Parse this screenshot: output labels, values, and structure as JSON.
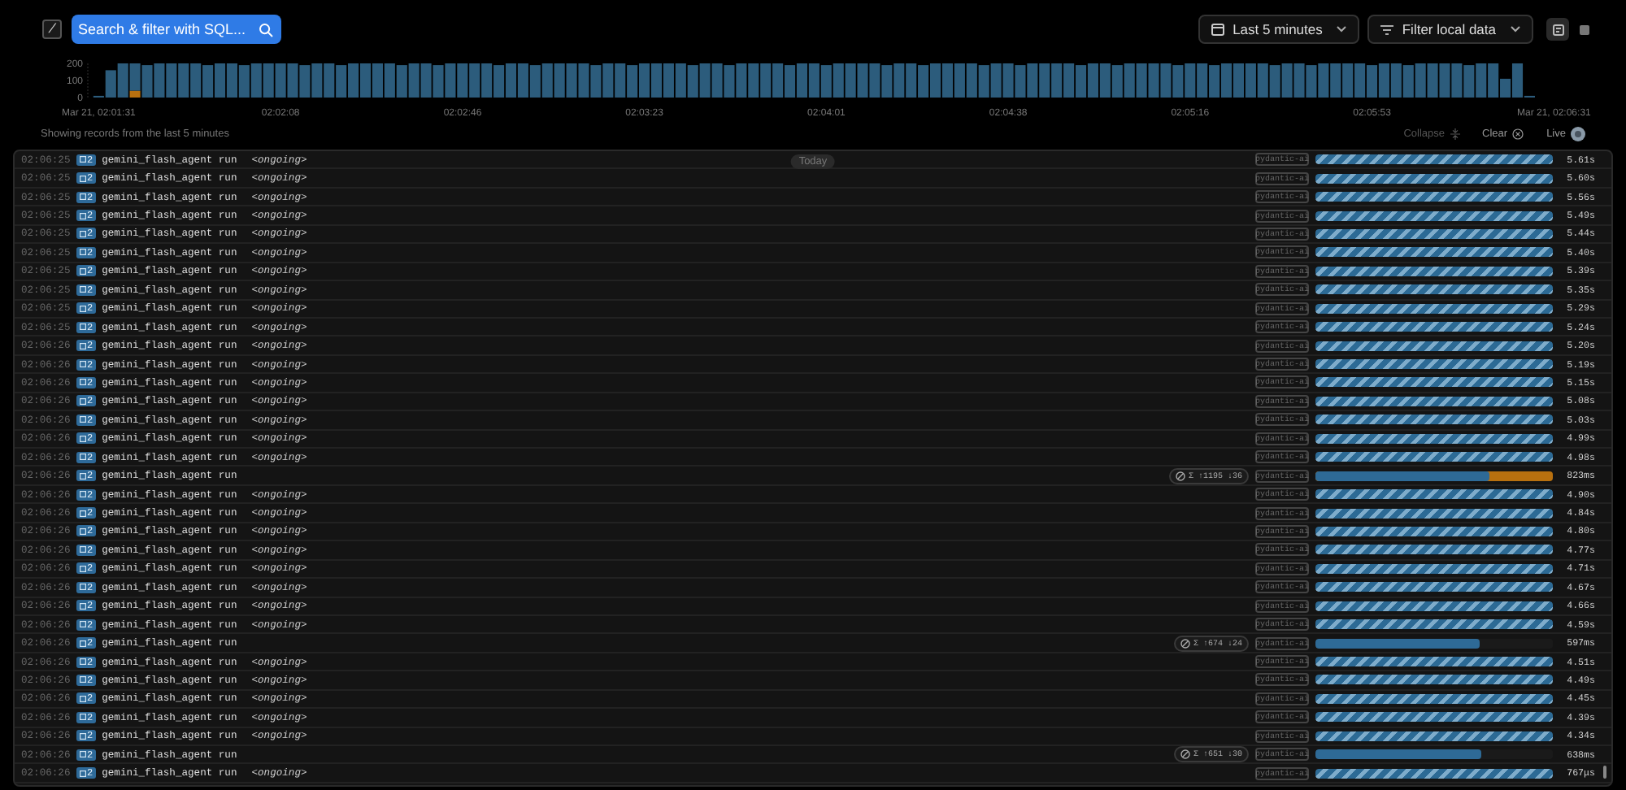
{
  "toolbar": {
    "shortcut_key": "/",
    "search": {
      "label": "Search & filter with SQL..."
    },
    "time_range": "Last 5 minutes",
    "filter": "Filter local data",
    "views": [
      {
        "kind": "timeline",
        "selected": true
      },
      {
        "kind": "list",
        "selected": false
      }
    ]
  },
  "chart_data": {
    "type": "bar",
    "stacked": true,
    "ylim": [
      0,
      200
    ],
    "yticks": [
      {
        "value": 0,
        "label": "0"
      },
      {
        "value": 100,
        "label": "100"
      },
      {
        "value": 200,
        "label": "200"
      }
    ],
    "categories": [
      "Mar 21, 02:01:31",
      null,
      null,
      null,
      null,
      null,
      null,
      null,
      null,
      null,
      null,
      null,
      null,
      null,
      null,
      "02:02:08",
      null,
      null,
      null,
      null,
      null,
      null,
      null,
      null,
      null,
      null,
      null,
      null,
      null,
      null,
      "02:02:46",
      null,
      null,
      null,
      null,
      null,
      null,
      null,
      null,
      null,
      null,
      null,
      null,
      null,
      null,
      "02:03:23",
      null,
      null,
      null,
      null,
      null,
      null,
      null,
      null,
      null,
      null,
      null,
      null,
      null,
      null,
      "02:04:01",
      null,
      null,
      null,
      null,
      null,
      null,
      null,
      null,
      null,
      null,
      null,
      null,
      null,
      null,
      "02:04:38",
      null,
      null,
      null,
      null,
      null,
      null,
      null,
      null,
      null,
      null,
      null,
      null,
      null,
      null,
      "02:05:16",
      null,
      null,
      null,
      null,
      null,
      null,
      null,
      null,
      null,
      null,
      null,
      null,
      null,
      null,
      "02:05:53",
      null,
      null,
      null,
      null,
      null,
      null,
      null,
      null,
      null,
      null,
      null,
      null,
      null,
      null,
      "Mar 21, 02:06:31"
    ],
    "series": [
      {
        "color": "#b8700f",
        "values": [
          0,
          0,
          0,
          40,
          0,
          0,
          0,
          0,
          0,
          0,
          0,
          0,
          0,
          0,
          0,
          0,
          0,
          0,
          0,
          0,
          0,
          0,
          0,
          0,
          0,
          0,
          0,
          0,
          0,
          0,
          0,
          0,
          0,
          0,
          0,
          0,
          0,
          0,
          0,
          0,
          0,
          0,
          0,
          0,
          0,
          0,
          0,
          0,
          0,
          0,
          0,
          0,
          0,
          0,
          0,
          0,
          0,
          0,
          0,
          0,
          0,
          0,
          0,
          0,
          0,
          0,
          0,
          0,
          0,
          0,
          0,
          0,
          0,
          0,
          0,
          0,
          0,
          0,
          0,
          0,
          0,
          0,
          0,
          0,
          0,
          0,
          0,
          0,
          0,
          0,
          0,
          0,
          0,
          0,
          0,
          0,
          0,
          0,
          0,
          0,
          0,
          0,
          0,
          0,
          0,
          0,
          0,
          0,
          0,
          0,
          0,
          0,
          0,
          0,
          0,
          0,
          0,
          0,
          0,
          0,
          0
        ]
      },
      {
        "color": "#2c5c7c",
        "values": [
          10,
          160,
          200,
          160,
          190,
          200,
          200,
          200,
          200,
          190,
          200,
          200,
          190,
          200,
          200,
          200,
          200,
          190,
          200,
          200,
          190,
          200,
          200,
          200,
          200,
          190,
          200,
          200,
          190,
          200,
          200,
          200,
          200,
          190,
          200,
          200,
          190,
          200,
          200,
          200,
          200,
          190,
          200,
          200,
          190,
          200,
          200,
          200,
          200,
          190,
          200,
          200,
          190,
          200,
          200,
          200,
          200,
          190,
          200,
          200,
          190,
          200,
          200,
          200,
          200,
          190,
          200,
          200,
          190,
          200,
          200,
          200,
          200,
          190,
          200,
          200,
          190,
          200,
          200,
          200,
          200,
          190,
          200,
          200,
          190,
          200,
          200,
          200,
          200,
          190,
          200,
          200,
          190,
          200,
          200,
          200,
          200,
          190,
          200,
          200,
          190,
          200,
          200,
          200,
          200,
          190,
          200,
          200,
          190,
          200,
          200,
          200,
          200,
          190,
          200,
          200,
          110,
          200,
          10,
          0,
          0
        ]
      }
    ]
  },
  "status": {
    "text": "Showing records from the last 5 minutes",
    "collapse": {
      "label": "Collapse",
      "disabled": true
    },
    "clear": "Clear",
    "live": "Live"
  },
  "date_divider": "Today",
  "rows": [
    {
      "time": "02:06:25",
      "count": "2",
      "name": "gemini_flash_agent run",
      "status": "<ongoing>",
      "tag": "pydantic-ai",
      "bar": {
        "kind": "striped",
        "level": 1
      },
      "duration": "5.61s"
    },
    {
      "time": "02:06:25",
      "count": "2",
      "name": "gemini_flash_agent run",
      "status": "<ongoing>",
      "tag": "pydantic-ai",
      "bar": {
        "kind": "striped",
        "level": 1
      },
      "duration": "5.60s"
    },
    {
      "time": "02:06:25",
      "count": "2",
      "name": "gemini_flash_agent run",
      "status": "<ongoing>",
      "tag": "pydantic-ai",
      "bar": {
        "kind": "striped",
        "level": 1
      },
      "duration": "5.56s"
    },
    {
      "time": "02:06:25",
      "count": "2",
      "name": "gemini_flash_agent run",
      "status": "<ongoing>",
      "tag": "pydantic-ai",
      "bar": {
        "kind": "striped",
        "level": 1
      },
      "duration": "5.49s"
    },
    {
      "time": "02:06:25",
      "count": "2",
      "name": "gemini_flash_agent run",
      "status": "<ongoing>",
      "tag": "pydantic-ai",
      "bar": {
        "kind": "striped",
        "level": 1
      },
      "duration": "5.44s"
    },
    {
      "time": "02:06:25",
      "count": "2",
      "name": "gemini_flash_agent run",
      "status": "<ongoing>",
      "tag": "pydantic-ai",
      "bar": {
        "kind": "striped",
        "level": 1
      },
      "duration": "5.40s"
    },
    {
      "time": "02:06:25",
      "count": "2",
      "name": "gemini_flash_agent run",
      "status": "<ongoing>",
      "tag": "pydantic-ai",
      "bar": {
        "kind": "striped",
        "level": 1
      },
      "duration": "5.39s"
    },
    {
      "time": "02:06:25",
      "count": "2",
      "name": "gemini_flash_agent run",
      "status": "<ongoing>",
      "tag": "pydantic-ai",
      "bar": {
        "kind": "striped",
        "level": 1
      },
      "duration": "5.35s"
    },
    {
      "time": "02:06:25",
      "count": "2",
      "name": "gemini_flash_agent run",
      "status": "<ongoing>",
      "tag": "pydantic-ai",
      "bar": {
        "kind": "striped",
        "level": 1
      },
      "duration": "5.29s"
    },
    {
      "time": "02:06:25",
      "count": "2",
      "name": "gemini_flash_agent run",
      "status": "<ongoing>",
      "tag": "pydantic-ai",
      "bar": {
        "kind": "striped",
        "level": 1
      },
      "duration": "5.24s"
    },
    {
      "time": "02:06:26",
      "count": "2",
      "name": "gemini_flash_agent run",
      "status": "<ongoing>",
      "tag": "pydantic-ai",
      "bar": {
        "kind": "striped",
        "level": 1
      },
      "duration": "5.20s"
    },
    {
      "time": "02:06:26",
      "count": "2",
      "name": "gemini_flash_agent run",
      "status": "<ongoing>",
      "tag": "pydantic-ai",
      "bar": {
        "kind": "striped",
        "level": 1
      },
      "duration": "5.19s"
    },
    {
      "time": "02:06:26",
      "count": "2",
      "name": "gemini_flash_agent run",
      "status": "<ongoing>",
      "tag": "pydantic-ai",
      "bar": {
        "kind": "striped",
        "level": 1
      },
      "duration": "5.15s"
    },
    {
      "time": "02:06:26",
      "count": "2",
      "name": "gemini_flash_agent run",
      "status": "<ongoing>",
      "tag": "pydantic-ai",
      "bar": {
        "kind": "striped",
        "level": 1
      },
      "duration": "5.08s"
    },
    {
      "time": "02:06:26",
      "count": "2",
      "name": "gemini_flash_agent run",
      "status": "<ongoing>",
      "tag": "pydantic-ai",
      "bar": {
        "kind": "striped",
        "level": 1
      },
      "duration": "5.03s"
    },
    {
      "time": "02:06:26",
      "count": "2",
      "name": "gemini_flash_agent run",
      "status": "<ongoing>",
      "tag": "pydantic-ai",
      "bar": {
        "kind": "striped",
        "level": 1
      },
      "duration": "4.99s"
    },
    {
      "time": "02:06:26",
      "count": "2",
      "name": "gemini_flash_agent run",
      "status": "<ongoing>",
      "tag": "pydantic-ai",
      "bar": {
        "kind": "striped",
        "level": 1
      },
      "duration": "4.98s"
    },
    {
      "time": "02:06:26",
      "count": "2",
      "name": "gemini_flash_agent run",
      "tokens": "Σ ↑1195 ↓36",
      "tag": "pydantic-ai",
      "bar": {
        "kind": "solid",
        "level": 0.73,
        "error": true
      },
      "duration": "823ms"
    },
    {
      "time": "02:06:26",
      "count": "2",
      "name": "gemini_flash_agent run",
      "status": "<ongoing>",
      "tag": "pydantic-ai",
      "bar": {
        "kind": "striped",
        "level": 1
      },
      "duration": "4.90s"
    },
    {
      "time": "02:06:26",
      "count": "2",
      "name": "gemini_flash_agent run",
      "status": "<ongoing>",
      "tag": "pydantic-ai",
      "bar": {
        "kind": "striped",
        "level": 1
      },
      "duration": "4.84s"
    },
    {
      "time": "02:06:26",
      "count": "2",
      "name": "gemini_flash_agent run",
      "status": "<ongoing>",
      "tag": "pydantic-ai",
      "bar": {
        "kind": "striped",
        "level": 1
      },
      "duration": "4.80s"
    },
    {
      "time": "02:06:26",
      "count": "2",
      "name": "gemini_flash_agent run",
      "status": "<ongoing>",
      "tag": "pydantic-ai",
      "bar": {
        "kind": "striped",
        "level": 1
      },
      "duration": "4.77s"
    },
    {
      "time": "02:06:26",
      "count": "2",
      "name": "gemini_flash_agent run",
      "status": "<ongoing>",
      "tag": "pydantic-ai",
      "bar": {
        "kind": "striped",
        "level": 1
      },
      "duration": "4.71s"
    },
    {
      "time": "02:06:26",
      "count": "2",
      "name": "gemini_flash_agent run",
      "status": "<ongoing>",
      "tag": "pydantic-ai",
      "bar": {
        "kind": "striped",
        "level": 1
      },
      "duration": "4.67s"
    },
    {
      "time": "02:06:26",
      "count": "2",
      "name": "gemini_flash_agent run",
      "status": "<ongoing>",
      "tag": "pydantic-ai",
      "bar": {
        "kind": "striped",
        "level": 1
      },
      "duration": "4.66s"
    },
    {
      "time": "02:06:26",
      "count": "2",
      "name": "gemini_flash_agent run",
      "status": "<ongoing>",
      "tag": "pydantic-ai",
      "bar": {
        "kind": "striped",
        "level": 1
      },
      "duration": "4.59s"
    },
    {
      "time": "02:06:26",
      "count": "2",
      "name": "gemini_flash_agent run",
      "tokens": "Σ ↑674 ↓24",
      "tag": "pydantic-ai",
      "bar": {
        "kind": "solid",
        "level": 0.69,
        "error": false
      },
      "duration": "597ms"
    },
    {
      "time": "02:06:26",
      "count": "2",
      "name": "gemini_flash_agent run",
      "status": "<ongoing>",
      "tag": "pydantic-ai",
      "bar": {
        "kind": "striped",
        "level": 1
      },
      "duration": "4.51s"
    },
    {
      "time": "02:06:26",
      "count": "2",
      "name": "gemini_flash_agent run",
      "status": "<ongoing>",
      "tag": "pydantic-ai",
      "bar": {
        "kind": "striped",
        "level": 1
      },
      "duration": "4.49s"
    },
    {
      "time": "02:06:26",
      "count": "2",
      "name": "gemini_flash_agent run",
      "status": "<ongoing>",
      "tag": "pydantic-ai",
      "bar": {
        "kind": "striped",
        "level": 1
      },
      "duration": "4.45s"
    },
    {
      "time": "02:06:26",
      "count": "2",
      "name": "gemini_flash_agent run",
      "status": "<ongoing>",
      "tag": "pydantic-ai",
      "bar": {
        "kind": "striped",
        "level": 1
      },
      "duration": "4.39s"
    },
    {
      "time": "02:06:26",
      "count": "2",
      "name": "gemini_flash_agent run",
      "status": "<ongoing>",
      "tag": "pydantic-ai",
      "bar": {
        "kind": "striped",
        "level": 1
      },
      "duration": "4.34s"
    },
    {
      "time": "02:06:26",
      "count": "2",
      "name": "gemini_flash_agent run",
      "tokens": "Σ ↑651 ↓30",
      "tag": "pydantic-ai",
      "bar": {
        "kind": "solid",
        "level": 0.7,
        "error": false
      },
      "duration": "638ms"
    },
    {
      "time": "02:06:26",
      "count": "2",
      "name": "gemini_flash_agent run",
      "status": "<ongoing>",
      "tag": "pydantic-ai",
      "bar": {
        "kind": "striped",
        "level": 1
      },
      "duration": "767μs"
    }
  ]
}
